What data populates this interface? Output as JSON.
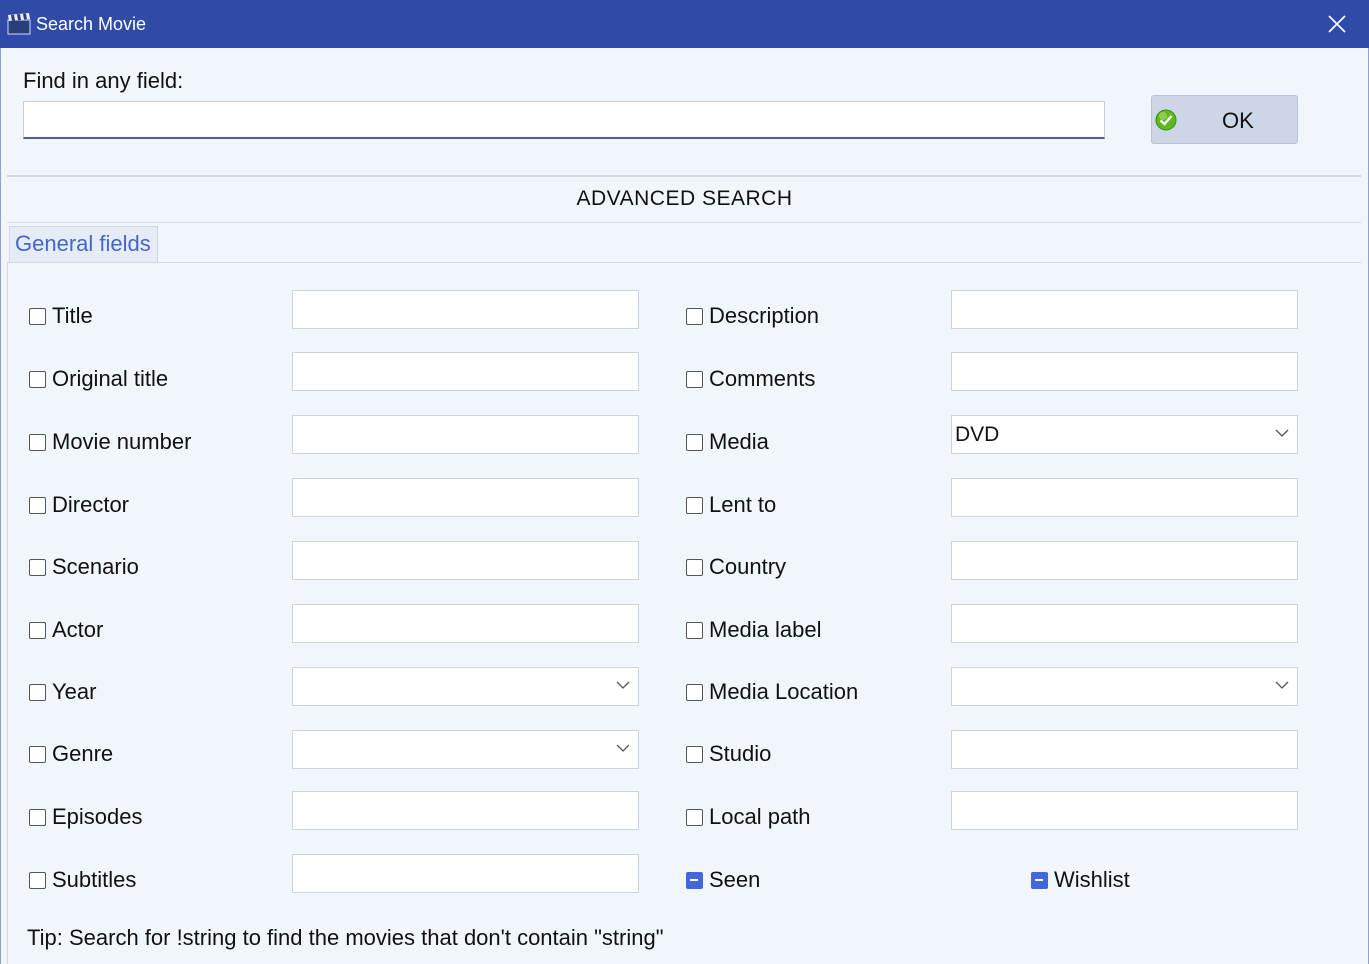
{
  "window": {
    "title": "Search Movie"
  },
  "find": {
    "label": "Find in any field:",
    "value": ""
  },
  "ok_button": {
    "label": "OK"
  },
  "advanced": {
    "heading": "ADVANCED SEARCH",
    "tab": "General fields"
  },
  "left_fields": [
    {
      "label": "Title",
      "value": ""
    },
    {
      "label": "Original title",
      "value": ""
    },
    {
      "label": "Movie number",
      "value": ""
    },
    {
      "label": "Director",
      "value": ""
    },
    {
      "label": "Scenario",
      "value": ""
    },
    {
      "label": "Actor",
      "value": ""
    },
    {
      "label": "Year",
      "value": ""
    },
    {
      "label": "Genre",
      "value": ""
    },
    {
      "label": "Episodes",
      "value": ""
    },
    {
      "label": "Subtitles",
      "value": ""
    }
  ],
  "right_fields": [
    {
      "label": "Description",
      "value": ""
    },
    {
      "label": "Comments",
      "value": ""
    },
    {
      "label": "Media",
      "value": "DVD"
    },
    {
      "label": "Lent to",
      "value": ""
    },
    {
      "label": "Country",
      "value": ""
    },
    {
      "label": "Media label",
      "value": ""
    },
    {
      "label": "Media Location",
      "value": ""
    },
    {
      "label": "Studio",
      "value": ""
    },
    {
      "label": "Local path",
      "value": ""
    }
  ],
  "seen": {
    "label": "Seen",
    "state": "indeterminate"
  },
  "wishlist": {
    "label": "Wishlist",
    "state": "indeterminate"
  },
  "tip": "Tip: Search for !string to find the movies that don't contain \"string\"",
  "colors": {
    "titlebar": "#304aa7",
    "accent": "#4466dd",
    "background": "#f1f6fd"
  }
}
